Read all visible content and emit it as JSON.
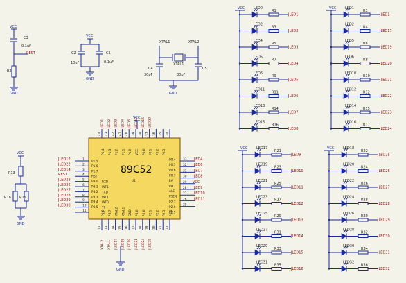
{
  "power": {
    "vcc": "VCC",
    "gnd": "GND"
  },
  "reset": {
    "cap": "C3",
    "cap_val": "0.1uF",
    "res": "R2",
    "net": "REST"
  },
  "osc_caps": {
    "c2": "C2",
    "c2_val": "10uF",
    "c1": "C1",
    "c1_val": "0.1uF"
  },
  "crystal": {
    "xtal1": "XTAL1",
    "xtal2": "XTAL2",
    "c4": "C4",
    "c4_val": "30pF",
    "c5": "C5",
    "c5_val": "30pF"
  },
  "divider": {
    "r13": "R13",
    "r18": "R18",
    "r15": "R15"
  },
  "mcu": {
    "name": "89C52",
    "ref": "U1",
    "left_nets": [
      "JLED12",
      "JLED22",
      "JLED14",
      "REST",
      "JLED23",
      "JLED26",
      "JLED27",
      "JLED28",
      "JLED29",
      "JLED30"
    ],
    "left_nums": [
      "1",
      "2",
      "3",
      "4",
      "5",
      "6",
      "7",
      "8",
      "9",
      "10",
      "11"
    ],
    "left_pins": [
      "P1.5",
      "P1.6",
      "P1.7",
      "RST",
      "P3.0",
      "P3.1",
      "P3.2",
      "P3.3",
      "P3.4",
      "P3.5"
    ],
    "left_pins2": [
      "RXD",
      "INT1",
      "TXD",
      "INT1",
      "INT0",
      "T0",
      "T1"
    ],
    "right_nets": [
      "JLED4",
      "JLED6",
      "JLED7",
      "JLED8",
      "VCC",
      "JLED9",
      "JLED10",
      "JLED11"
    ],
    "right_nums": [
      "33",
      "32",
      "31",
      "30",
      "29",
      "28",
      "27",
      "26",
      "25"
    ],
    "right_pins": [
      "P0.4",
      "P0.5",
      "P0.6",
      "P0.7",
      "EA",
      "P4.1",
      "ALE",
      "PSEN",
      "P2.7",
      "P2.6",
      "P2.5"
    ],
    "top_nets": [
      "JLED1",
      "JLED2",
      "JLED3",
      "JLED4",
      "JLED5",
      "JLED13",
      "JLED15",
      "JLED20"
    ],
    "top_nums": [
      "44",
      "43",
      "42",
      "41",
      "40",
      "39",
      "38",
      "37",
      "36",
      "35",
      "34"
    ],
    "bottom_nets": [
      "XTAL2",
      "XTAL1",
      "JLED17",
      "JLED18",
      "JLED19",
      "JLED21",
      "JLED24",
      "JLED25"
    ],
    "bottom_nums": [
      "12",
      "13",
      "14",
      "15",
      "16",
      "17",
      "18",
      "19",
      "20",
      "21",
      "22"
    ],
    "pin_top_top": [
      "P1.4",
      "P1.3",
      "P1.2",
      "P1.1",
      "P1.0",
      "VCC",
      "P0.0",
      "P0.1",
      "P0.2",
      "P0.3"
    ],
    "pin_bot_bot": [
      "P3.6",
      "P3.7",
      "XTAL2",
      "XTAL1",
      "GND",
      "P4.0",
      "P2.0",
      "P2.1",
      "P2.2",
      "P2.3",
      "P2.4"
    ]
  },
  "led_groups": [
    {
      "leds": [
        "LED0",
        "LED2",
        "LED4",
        "LED5",
        "LED6",
        "LED11",
        "LED13",
        "LED15"
      ],
      "res": [
        "R1",
        "R3",
        "R5",
        "R7",
        "R9",
        "R11",
        "R14",
        "R16"
      ],
      "nets": [
        "JLED1",
        "JLED2",
        "JLED3",
        "JLED4",
        "JLED5",
        "JLED6",
        "JLED7",
        "JLED8"
      ]
    },
    {
      "leds": [
        "LED1",
        "LED2",
        "LED5",
        "LED6",
        "LED10",
        "LED12",
        "LED14",
        "LED16"
      ],
      "res": [
        "R1",
        "R4",
        "R6",
        "R8",
        "R10",
        "R12",
        "R15",
        "R17"
      ],
      "nets": [
        "JLED1",
        "JLED17",
        "JLED19",
        "JLED20",
        "JLED21",
        "JLED22",
        "JLED23",
        "JLED24"
      ]
    },
    {
      "leds": [
        "LED17",
        "LED19",
        "LED21",
        "LED23",
        "LED25",
        "LED27",
        "LED29",
        "LED31"
      ],
      "res": [
        "R21",
        "R23",
        "R25",
        "R27",
        "R29",
        "R31",
        "R33",
        "R35"
      ],
      "nets": [
        "JLED9",
        "JLED10",
        "JLED11",
        "JLED12",
        "JLED13",
        "JLED14",
        "JLED15",
        "JLED16"
      ]
    },
    {
      "leds": [
        "LED18",
        "LED20",
        "LED22",
        "LED24",
        "LED26",
        "LED28",
        "LED30",
        "LED32"
      ],
      "res": [
        "R22",
        "R24",
        "R26",
        "R28",
        "R30",
        "R32",
        "R34",
        "R36"
      ],
      "nets": [
        "JLED25",
        "JLED26",
        "JLED27",
        "JLED28",
        "JLED29",
        "JLED30",
        "JLED31",
        "JLED32"
      ]
    }
  ]
}
